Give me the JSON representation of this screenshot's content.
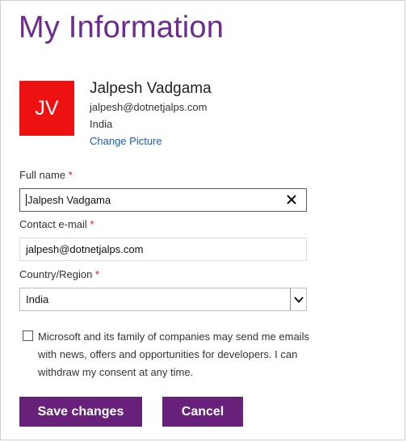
{
  "page": {
    "title": "My Information"
  },
  "profile": {
    "initials": "JV",
    "name": "Jalpesh Vadgama",
    "email": "jalpesh@dotnetjalps.com",
    "country": "India",
    "change_picture_label": "Change Picture",
    "avatar_color": "#ee1111"
  },
  "form": {
    "full_name": {
      "label": "Full name",
      "required_mark": "*",
      "value": "Jalpesh Vadgama"
    },
    "contact_email": {
      "label": "Contact e-mail",
      "required_mark": "*",
      "value": "jalpesh@dotnetjalps.com"
    },
    "country_region": {
      "label": "Country/Region",
      "required_mark": "*",
      "selected": "India"
    },
    "consent": {
      "checked": false,
      "text": "Microsoft and its family of companies may send me emails with news, offers and opportunities for developers. I can withdraw my consent at any time."
    }
  },
  "actions": {
    "save_label": "Save changes",
    "cancel_label": "Cancel"
  },
  "colors": {
    "accent": "#68217a",
    "title": "#6b2b8f",
    "link": "#1a5fb4",
    "required": "#d9161e"
  },
  "icons": {
    "clear": "close-icon",
    "dropdown": "chevron-down-icon"
  }
}
